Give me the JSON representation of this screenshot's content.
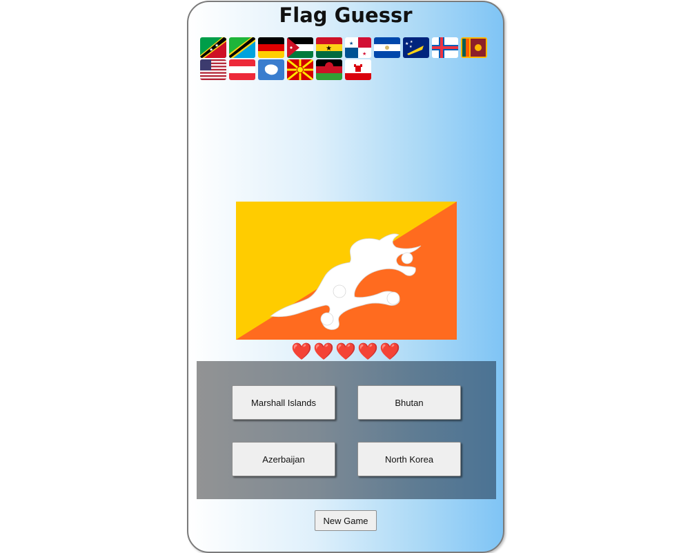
{
  "app": {
    "title": "Flag Guessr"
  },
  "history": {
    "flags": [
      "saint-kitts-and-nevis-flag-icon",
      "tanzania-flag-icon",
      "germany-flag-icon",
      "jordan-flag-icon",
      "ghana-flag-icon",
      "panama-flag-icon",
      "el-salvador-flag-icon",
      "tokelau-flag-icon",
      "faroe-islands-flag-icon",
      "sri-lanka-flag-icon",
      "united-states-flag-icon",
      "austria-flag-icon",
      "antarctica-flag-icon",
      "north-macedonia-flag-icon",
      "malawi-flag-icon",
      "gibraltar-flag-icon"
    ]
  },
  "question": {
    "flag_icon": "bhutan-flag-icon",
    "flag_colors": {
      "yellow": "#ffcc00",
      "orange": "#ff6b1f",
      "dragon": "#ffffff"
    }
  },
  "lives": {
    "count": 5,
    "glyph": "❤️"
  },
  "options": [
    {
      "label": "Marshall Islands"
    },
    {
      "label": "Bhutan"
    },
    {
      "label": "Azerbaijan"
    },
    {
      "label": "North Korea"
    }
  ],
  "controls": {
    "new_game_label": "New Game"
  }
}
